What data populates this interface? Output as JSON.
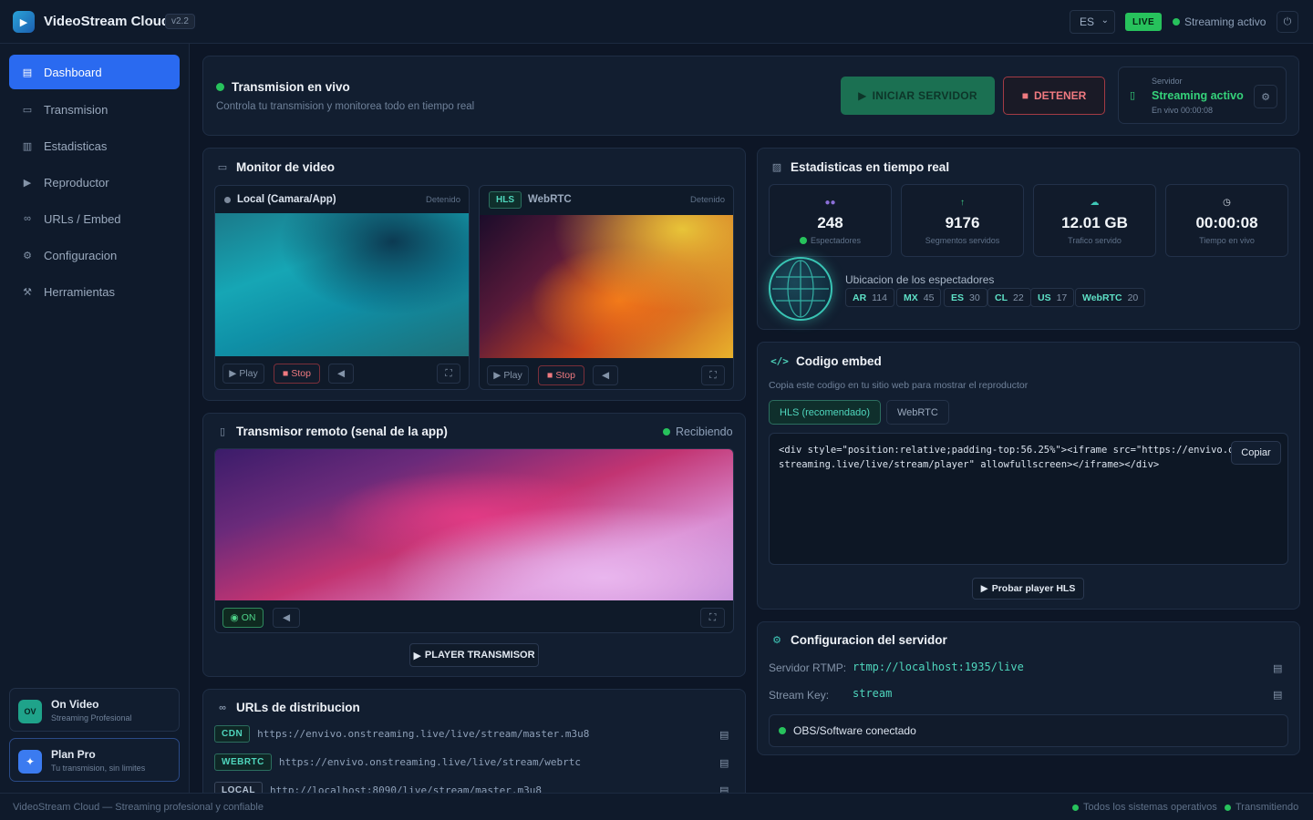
{
  "app": {
    "title": "VideoStream Cloud",
    "version": "v2.2",
    "logo_icon": "play-logo-icon"
  },
  "topbar": {
    "language": "ES",
    "live_badge": "LIVE",
    "status": "Streaming activo"
  },
  "sidebar": {
    "items": [
      {
        "label": "Dashboard",
        "icon": "dashboard-icon",
        "active": true
      },
      {
        "label": "Transmision",
        "icon": "broadcast-icon"
      },
      {
        "label": "Estadisticas",
        "icon": "stats-icon"
      },
      {
        "label": "Reproductor",
        "icon": "play-icon"
      },
      {
        "label": "URLs / Embed",
        "icon": "link-icon"
      },
      {
        "label": "Configuracion",
        "icon": "gear-icon"
      },
      {
        "label": "Herramientas",
        "icon": "wrench-icon"
      }
    ],
    "brand_card": {
      "initials": "OV",
      "title": "On Video",
      "subtitle": "Streaming Profesional"
    },
    "plan_card": {
      "title": "Plan Pro",
      "subtitle": "Tu transmision, sin limites"
    }
  },
  "header": {
    "title": "Transmision en vivo",
    "subtitle": "Controla tu transmision y monitorea todo en tiempo real",
    "start_label": "INICIAR SERVIDOR",
    "stop_label": "DETENER",
    "server": {
      "label": "Servidor",
      "value": "Streaming activo",
      "sub": "En vivo 00:00:08"
    }
  },
  "monitor": {
    "title": "Monitor de video",
    "local": {
      "label": "Local (Camara/App)",
      "status": "Detenido",
      "play": "Play",
      "stop": "Stop"
    },
    "remote": {
      "tab_hls": "HLS",
      "tab_webrtc": "WebRTC",
      "status": "Detenido",
      "play": "Play",
      "stop": "Stop"
    }
  },
  "transmitter": {
    "title": "Transmisor remoto (senal de la app)",
    "status": "Recibiendo",
    "on_label": "ON",
    "player_button": "PLAYER TRANSMISOR"
  },
  "urls": {
    "title": "URLs de distribucion",
    "rows": [
      {
        "tag": "CDN",
        "url": "https://envivo.onstreaming.live/live/stream/master.m3u8"
      },
      {
        "tag": "WEBRTC",
        "url": "https://envivo.onstreaming.live/live/stream/webrtc"
      },
      {
        "tag": "LOCAL",
        "url": "http://localhost:8090/live/stream/master.m3u8"
      }
    ]
  },
  "stats": {
    "title": "Estadisticas en tiempo real",
    "cards": [
      {
        "value": "248",
        "label": "Espectadores",
        "icon": "users-icon"
      },
      {
        "value": "9176",
        "label": "Segmentos servidos",
        "icon": "arrow-up-icon"
      },
      {
        "value": "12.01 GB",
        "label": "Trafico servido",
        "icon": "cloud-icon"
      },
      {
        "value": "00:00:08",
        "label": "Tiempo en vivo",
        "icon": "clock-icon"
      }
    ],
    "geo_title": "Ubicacion de los espectadores",
    "geo": [
      {
        "code": "AR",
        "count": "114"
      },
      {
        "code": "MX",
        "count": "45"
      },
      {
        "code": "ES",
        "count": "30"
      },
      {
        "code": "CL",
        "count": "22"
      },
      {
        "code": "US",
        "count": "17"
      },
      {
        "code": "WebRTC",
        "count": "20"
      }
    ]
  },
  "embed": {
    "title": "Codigo embed",
    "subtitle": "Copia este codigo en tu sitio web para mostrar el reproductor",
    "tab_hls": "HLS (recomendado)",
    "tab_webrtc": "WebRTC",
    "code_line1": "<div style=\"position:relative;padding-top:56.25%\"><iframe src=\"https://envivo.on",
    "code_line2": "streaming.live/live/stream/player\" allowfullscreen></iframe></div>",
    "copy_label": "Copiar",
    "test_button": "Probar player HLS"
  },
  "config": {
    "title": "Configuracion del servidor",
    "rtmp_label": "Servidor RTMP:",
    "rtmp_value": "rtmp://localhost:1935/live",
    "key_label": "Stream Key:",
    "key_value": "stream",
    "obs_status": "OBS/Software conectado"
  },
  "footer": {
    "left": "VideoStream Cloud — Streaming profesional y confiable",
    "status1": "Todos los sistemas operativos",
    "status2": "Transmitiendo"
  },
  "colors": {
    "accent": "#2a6af0",
    "live": "#27c25c",
    "teal": "#4fd6bd",
    "danger": "#f07a80"
  }
}
